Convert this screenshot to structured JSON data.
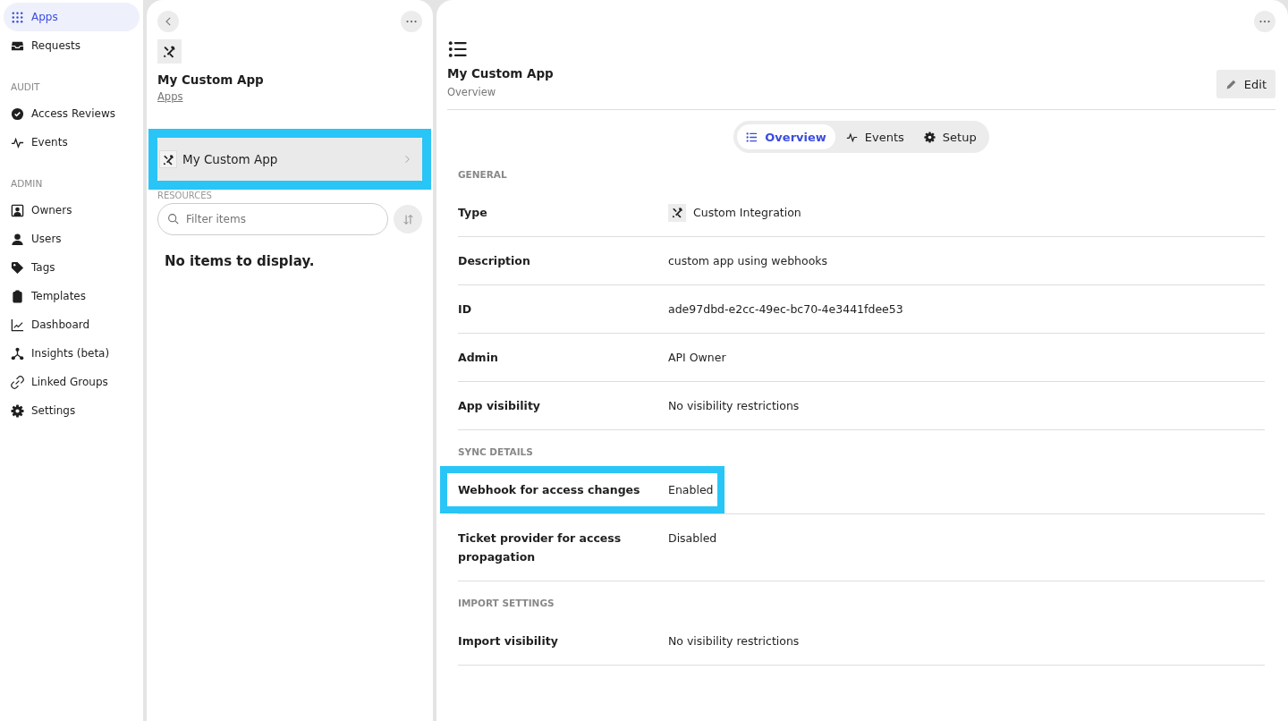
{
  "sidebar": {
    "sections": [
      {
        "items": [
          {
            "label": "Apps",
            "selected": true
          },
          {
            "label": "Requests",
            "selected": false
          }
        ]
      },
      {
        "title": "AUDIT",
        "items": [
          {
            "label": "Access Reviews",
            "selected": false
          },
          {
            "label": "Events",
            "selected": false
          }
        ]
      },
      {
        "title": "ADMIN",
        "items": [
          {
            "label": "Owners",
            "selected": false
          },
          {
            "label": "Users",
            "selected": false
          },
          {
            "label": "Tags",
            "selected": false
          },
          {
            "label": "Templates",
            "selected": false
          },
          {
            "label": "Dashboard",
            "selected": false
          },
          {
            "label": "Insights (beta)",
            "selected": false
          },
          {
            "label": "Linked Groups",
            "selected": false
          },
          {
            "label": "Settings",
            "selected": false
          }
        ]
      }
    ]
  },
  "middle_panel": {
    "title": "My Custom App",
    "breadcrumb": "Apps",
    "resource_item": {
      "label": "My Custom App",
      "highlighted": true
    },
    "section_title": "RESOURCES",
    "filter": {
      "placeholder": "Filter items"
    },
    "empty_message": "No items to display."
  },
  "detail_panel": {
    "title": "My Custom App",
    "subtitle": "Overview",
    "edit_button": "Edit",
    "tabs": [
      {
        "label": "Overview",
        "selected": true
      },
      {
        "label": "Events",
        "selected": false
      },
      {
        "label": "Setup",
        "selected": false
      }
    ],
    "sections": [
      {
        "title": "GENERAL",
        "rows": [
          {
            "label": "Type",
            "value": "Custom Integration",
            "kind": "app",
            "highlighted": false
          },
          {
            "label": "Description",
            "value": "custom app using webhooks",
            "kind": "text",
            "highlighted": false
          },
          {
            "label": "ID",
            "value": "ade97dbd-e2cc-49ec-bc70-4e3441fdee53",
            "kind": "text",
            "highlighted": false
          },
          {
            "label": "Admin",
            "value": "API Owner",
            "kind": "text",
            "highlighted": false
          },
          {
            "label": "App visibility",
            "value": "No visibility restrictions",
            "kind": "text",
            "highlighted": false
          }
        ]
      },
      {
        "title": "SYNC DETAILS",
        "rows": [
          {
            "label": "Webhook for access changes",
            "value": "Enabled",
            "kind": "text",
            "highlighted": true
          },
          {
            "label": "Ticket provider for access propagation",
            "value": "Disabled",
            "kind": "text",
            "highlighted": false
          }
        ]
      },
      {
        "title": "IMPORT SETTINGS",
        "rows": [
          {
            "label": "Import visibility",
            "value": "No visibility restrictions",
            "kind": "text",
            "highlighted": false
          }
        ]
      }
    ]
  }
}
